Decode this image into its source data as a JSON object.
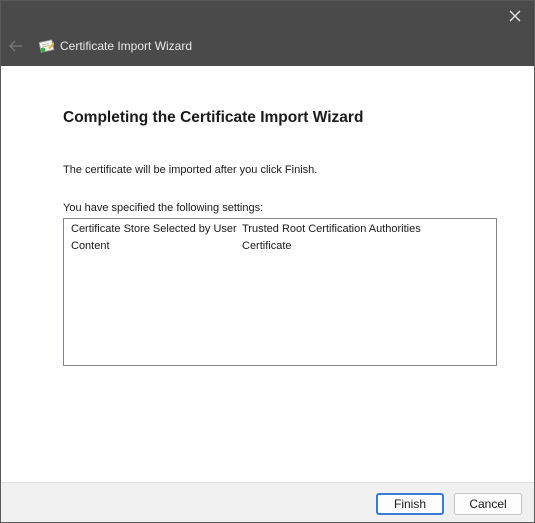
{
  "window": {
    "title": "Certificate Import Wizard"
  },
  "content": {
    "heading": "Completing the Certificate Import Wizard",
    "intro": "The certificate will be imported after you click Finish.",
    "settings_label": "You have specified the following settings:",
    "settings": [
      {
        "key": "Certificate Store Selected by User",
        "value": "Trusted Root Certification Authorities"
      },
      {
        "key": "Content",
        "value": "Certificate"
      }
    ]
  },
  "buttons": {
    "finish": "Finish",
    "cancel": "Cancel"
  },
  "colors": {
    "titlebar": "#4a4a4a",
    "default_button_border": "#3a7bd5",
    "footer": "#f0f0f0"
  },
  "icons": {
    "close": "close-icon",
    "back": "back-arrow-icon",
    "app": "certificate-icon"
  }
}
